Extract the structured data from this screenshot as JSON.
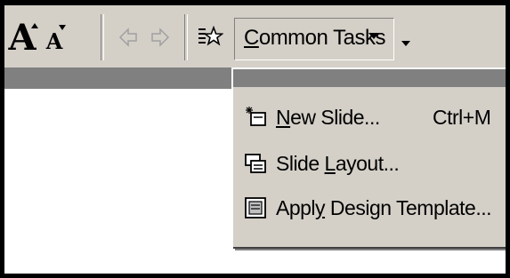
{
  "toolbar": {
    "increase_font_glyph": "A",
    "decrease_font_glyph": "A",
    "common_tasks": {
      "label_accel": "C",
      "label_rest": "ommon Tasks"
    }
  },
  "menu": {
    "items": [
      {
        "accel": "N",
        "rest": "ew Slide...",
        "prefix": "",
        "shortcut": "Ctrl+M",
        "icon": "new-slide-icon"
      },
      {
        "prefix": "Slide ",
        "accel": "L",
        "rest": "ayout...",
        "shortcut": "",
        "icon": "slide-layout-icon"
      },
      {
        "prefix": "Appl",
        "accel": "y",
        "rest": " Design Template...",
        "shortcut": "",
        "icon": "design-template-icon"
      }
    ]
  }
}
